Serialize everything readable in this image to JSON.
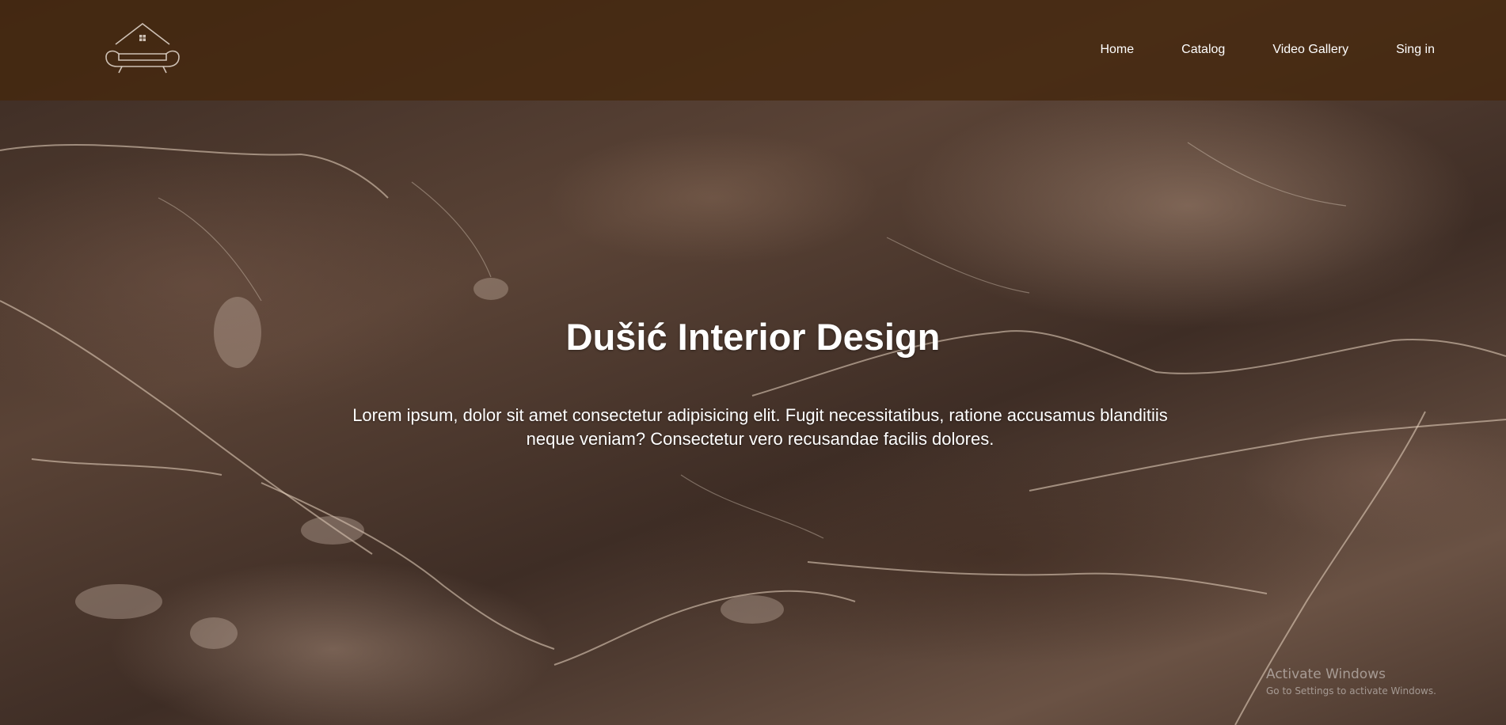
{
  "nav": {
    "items": [
      {
        "label": "Home"
      },
      {
        "label": "Catalog"
      },
      {
        "label": "Video Gallery"
      },
      {
        "label": "Sing in"
      }
    ]
  },
  "hero": {
    "title": "Dušić Interior Design",
    "text": "Lorem ipsum, dolor sit amet consectetur adipisicing elit. Fugit necessitatibus, ratione accusamus blanditiis neque veniam? Consectetur vero recusandae facilis dolores."
  },
  "watermark": {
    "title": "Activate Windows",
    "subtitle": "Go to Settings to activate Windows."
  },
  "colors": {
    "header_bg": "#46280f",
    "text": "#ffffff",
    "marble_base": "#4a3528"
  },
  "icons": {
    "logo": "sofa-house-logo-icon"
  }
}
